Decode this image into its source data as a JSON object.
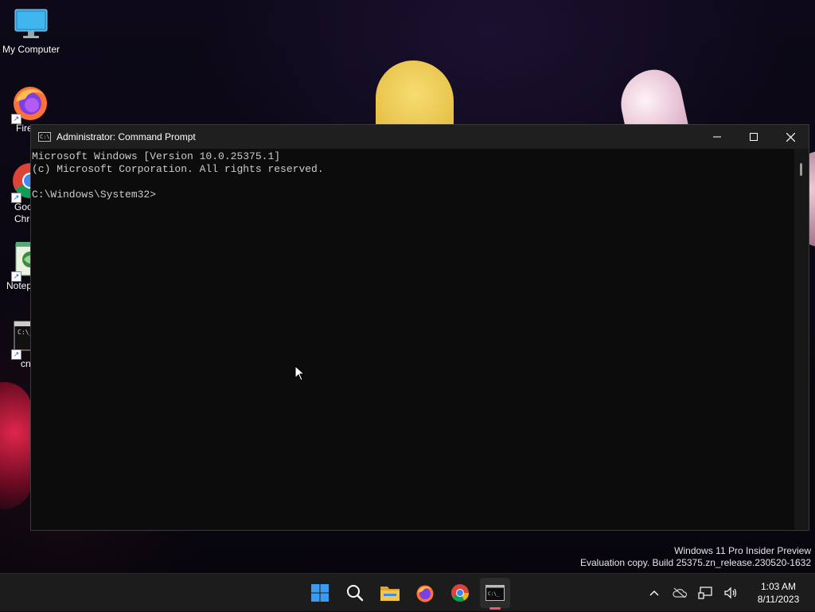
{
  "desktop": {
    "icons": [
      {
        "label": "My Computer",
        "icon": "monitor-icon"
      },
      {
        "label": "Fire",
        "icon": "firefox-icon"
      },
      {
        "label": "Goo\nChro",
        "icon": "chrome-icon"
      },
      {
        "label": "Notep",
        "icon": "notepad-icon"
      },
      {
        "label": "cn",
        "icon": "cmd-icon"
      }
    ]
  },
  "window": {
    "title": "Administrator: Command Prompt",
    "console_lines": [
      "Microsoft Windows [Version 10.0.25375.1]",
      "(c) Microsoft Corporation. All rights reserved.",
      "",
      "C:\\Windows\\System32>"
    ],
    "controls": [
      "minimize-icon",
      "maximize-icon",
      "close-icon"
    ]
  },
  "watermark": {
    "line1": "Windows 11 Pro Insider Preview",
    "line2": "Evaluation copy. Build 25375.zn_release.230520-1632"
  },
  "taskbar": {
    "apps": [
      "start-icon",
      "search-icon",
      "file-explorer-icon",
      "firefox-icon",
      "chrome-icon",
      "terminal-icon"
    ],
    "active_app": "terminal-icon",
    "active_indicator_color": "#ee5a6a"
  },
  "tray": {
    "icons": [
      "chevron-up-icon",
      "onedrive-offline-icon",
      "network-icon",
      "volume-icon"
    ],
    "time": "1:03 AM",
    "date": "8/11/2023"
  },
  "colors": {
    "console_bg": "#0c0c0c",
    "console_text": "#cccccc",
    "titlebar_bg": "#1f1f1f",
    "taskbar_bg": "#1c1c1c"
  }
}
